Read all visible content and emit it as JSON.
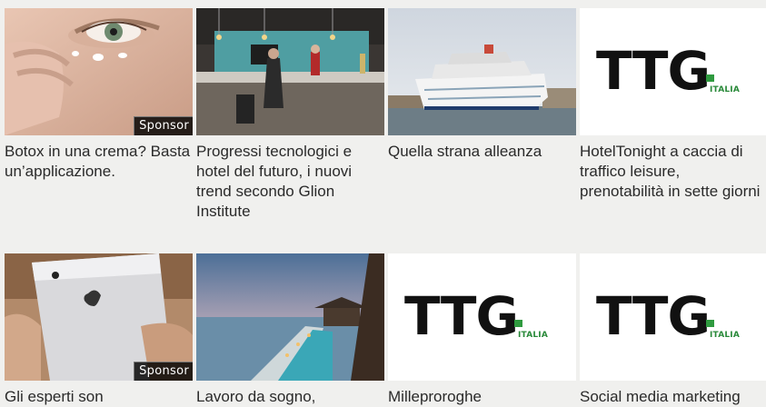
{
  "sponsor_label": "Sponsor",
  "logo": {
    "main": "TTG",
    "sub": "ITALIA",
    "accent": "#2f9a3f"
  },
  "articles": [
    {
      "title": "Botox in una crema? Basta un’applicazione.",
      "sponsored": true
    },
    {
      "title": "Progressi tecnologici e hotel del futuro, i nuovi trend secondo Glion Institute",
      "sponsored": false
    },
    {
      "title": "Quella strana alleanza",
      "sponsored": false
    },
    {
      "title": "HotelTonight a caccia di traffico leisure, prenotabilità in sette giorni",
      "sponsored": false
    },
    {
      "title": "Gli esperti son",
      "sponsored": true
    },
    {
      "title": "Lavoro da sogno,",
      "sponsored": false
    },
    {
      "title": "Milleproroghe",
      "sponsored": false
    },
    {
      "title": "Social media marketing",
      "sponsored": false
    }
  ]
}
